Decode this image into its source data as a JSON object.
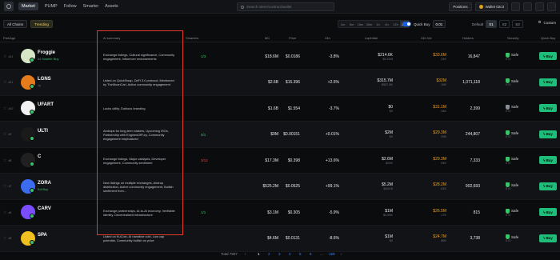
{
  "nav": {
    "tabs": [
      "Market",
      "PUMP",
      "Follow",
      "Smarter",
      "Assets"
    ]
  },
  "search": {
    "placeholder": "Search token/contract/wallet"
  },
  "top_right": {
    "positions": "Positions",
    "wallet": "Wallet 02c3"
  },
  "filters": {
    "chains": "All Chains",
    "trending": "Trending"
  },
  "timeframes": [
    "1m",
    "5m",
    "15m",
    "30m",
    "1h",
    "4h",
    "12h",
    "24h"
  ],
  "active_timeframe": "24h",
  "quick_buy": {
    "label": "Quick Buy",
    "value": "0.01"
  },
  "presets": {
    "label": "Default",
    "items": [
      "S1",
      "S2",
      "S3"
    ]
  },
  "custom": "Custom",
  "columns": {
    "pair": "Pair/Age",
    "summary": "AI summary",
    "smarters": "Smarters",
    "mc": "MC",
    "price": "Price",
    "change": "24h",
    "liq": "Liq/Initial",
    "vol": "24h Vol",
    "holders": "Holders",
    "security": "Security",
    "quick_buy": "Quick Buy"
  },
  "rows": [
    {
      "rank": "#12",
      "name": "Froggie",
      "sub": "8d",
      "smart": "Smarter Buy",
      "summary": "Exchange listings, Cultural significance, Community engagement, Influencer endorsements",
      "smarters": "1/3",
      "mc": "$18.6M",
      "price": "$0.0186",
      "change": "-3.8%",
      "liq": "$214.6K",
      "liq2": "$5.91M",
      "vol": "$33.6M",
      "vol2": "24K",
      "holders": "16,847",
      "sec": "Safe",
      "sec2": "0 /0",
      "avatar": "#d8e6c8"
    },
    {
      "rank": "#11",
      "name": "LGNS",
      "sub": "1y",
      "smart": "",
      "summary": "Listed on QuickSwap, DeFi 3.0 protocol, Mentioned by TheMoonCarl, Active community engagement",
      "smarters": "",
      "mc": "$2.6B",
      "price": "$15.396",
      "change": "+2.5%",
      "liq": "$315.7M",
      "liq2": "$557.8K",
      "vol": "$32M",
      "vol2": "15K",
      "holders": "1,071,118",
      "sec": "Safe",
      "sec2": "0 /0",
      "avatar": "#e57b1a"
    },
    {
      "rank": "#10",
      "name": "UFART",
      "sub": "",
      "smart": "",
      "summary": "Lacks utility, Dubious branding",
      "smarters": "",
      "mc": "$1.6B",
      "price": "$1.554",
      "change": "-3.7%",
      "liq": "$0",
      "liq2": "$0",
      "vol": "$31.1M",
      "vol2": "34K",
      "holders": "2,399",
      "sec": "Safe",
      "sec2": "0 /0",
      "avatar": "#f2f2f2"
    },
    {
      "rank": "#9",
      "name": "ULTI",
      "sub": "",
      "smart": "",
      "summary": "Airdrops for long-term stakers, Upcoming ISOs, Partnership with EnginesOfFury, Community engagement emphasized",
      "smarters": "0/1",
      "mc": "$9M",
      "price": "$0.00151",
      "change": "+0.01%",
      "liq": "$2M",
      "liq2": "$0",
      "vol": "$29.3M",
      "vol2": "29K",
      "holders": "244,807",
      "sec": "Safe",
      "sec2": "0 /0",
      "avatar": "#1a1a1a"
    },
    {
      "rank": "#8",
      "name": "C",
      "sub": "",
      "smart": "",
      "summary": "Exchange listings, Major catalysts, Developer engagement, Community sentiment",
      "smarters": "3/12",
      "mc": "$17.3M",
      "price": "$0.398",
      "change": "+13.6%",
      "liq": "$2.6M",
      "liq2": "$20K",
      "vol": "$29.3M",
      "vol2": "94K",
      "holders": "7,333",
      "sec": "Safe",
      "sec2": "0 /0",
      "avatar": "#202020"
    },
    {
      "rank": "#7",
      "name": "ZORA",
      "sub": "",
      "smart": "Kol Buy",
      "summary": "New listings on multiple exchanges, Airdrop distribution, Active community engagement, Bullish sentiment from...",
      "smarters": "",
      "mc": "$525.2M",
      "price": "$0.0525",
      "change": "+99.1%",
      "liq": "$5.2M",
      "liq2": "$404.6",
      "vol": "$28.2M",
      "vol2": "61K",
      "holders": "902,693",
      "sec": "Safe",
      "sec2": "0 /0",
      "avatar": "#3b6cf0"
    },
    {
      "rank": "#6",
      "name": "CARV",
      "sub": "",
      "smart": "",
      "summary": "Exchange partnerships, AI-to-AI economy, Verifiable identity, Decentralized infrastructure",
      "smarters": "1/1",
      "mc": "$3.1M",
      "price": "$0.305",
      "change": "-5.9%",
      "liq": "$1M",
      "liq2": "$4.95K",
      "vol": "$26.5M",
      "vol2": "17K",
      "holders": "815",
      "sec": "Safe",
      "sec2": "0 /0",
      "avatar": "#7b4dff"
    },
    {
      "rank": "#5",
      "name": "SPA",
      "sub": "",
      "smart": "",
      "summary": "Listed on KuCoin, AI narrative coin, Low cap potential, Community bullish on price",
      "smarters": "",
      "mc": "$4.6M",
      "price": "$0.0131",
      "change": "-8.6%",
      "liq": "$1M",
      "liq2": "$0",
      "vol": "$24.7M",
      "vol2": "86K",
      "holders": "3,738",
      "sec": "Safe",
      "sec2": "0 /0",
      "avatar": "#f0c020"
    }
  ],
  "buy_label": "Buy",
  "pager": {
    "total": "Total 7907",
    "pages": [
      "1",
      "2",
      "3",
      "4",
      "5",
      "6",
      "...",
      "159"
    ],
    "current": "1"
  }
}
